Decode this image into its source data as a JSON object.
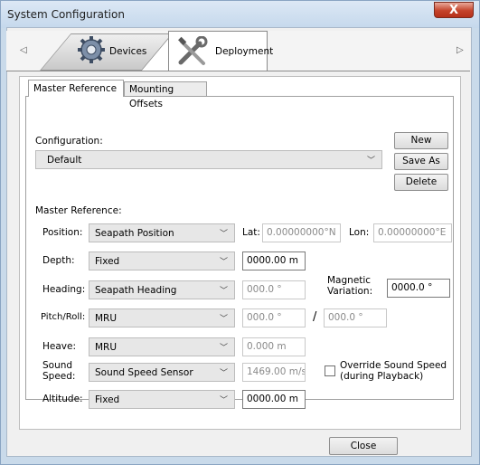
{
  "window": {
    "title": "System Configuration",
    "close_glyph": "X"
  },
  "outer_tabs": [
    {
      "label": "Devices",
      "icon": "gear-icon"
    },
    {
      "label": "Deployment",
      "icon": "tools-icon"
    }
  ],
  "scroll_arrows": {
    "left": "◁",
    "right": "▷"
  },
  "inner_tabs": [
    {
      "label": "Master Reference"
    },
    {
      "label": "Mounting Offsets"
    }
  ],
  "configuration": {
    "label": "Configuration:",
    "selected": "Default",
    "buttons": {
      "new": "New",
      "save_as": "Save As",
      "delete": "Delete"
    }
  },
  "master_reference": {
    "label": "Master Reference:",
    "position": {
      "label": "Position:",
      "source": "Seapath Position",
      "lat_label": "Lat:",
      "lat": "0.00000000°N",
      "lon_label": "Lon:",
      "lon": "0.00000000°E"
    },
    "depth": {
      "label": "Depth:",
      "source": "Fixed",
      "value": "0000.00 m"
    },
    "heading": {
      "label": "Heading:",
      "source": "Seapath Heading",
      "value": "000.0 °",
      "magnetic_label_1": "Magnetic",
      "magnetic_label_2": "Variation:",
      "magnetic_value": "0000.0 °"
    },
    "pitch_roll": {
      "label": "Pitch/Roll:",
      "source": "MRU",
      "pitch": "000.0 °",
      "separator": "/",
      "roll": "000.0 °"
    },
    "heave": {
      "label": "Heave:",
      "source": "MRU",
      "value": "0.000 m"
    },
    "sound_speed": {
      "label_1": "Sound",
      "label_2": "Speed:",
      "source": "Sound Speed Sensor",
      "value": "1469.00 m/s",
      "override_1": "Override Sound Speed",
      "override_2": "(during Playback)",
      "override_checked": false
    },
    "altitude": {
      "label": "Altitude:",
      "source": "Fixed",
      "value": "0000.00 m"
    }
  },
  "footer": {
    "close": "Close"
  }
}
